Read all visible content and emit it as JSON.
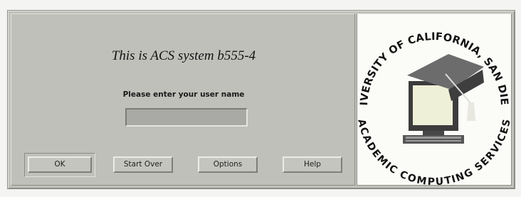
{
  "dialog": {
    "title": "This is ACS system b555-4",
    "prompt": "Please enter your user name",
    "username_value": ""
  },
  "buttons": {
    "ok": "OK",
    "start_over": "Start Over",
    "options": "Options",
    "help": "Help"
  },
  "logo": {
    "top_text": "UNIVERSITY OF CALIFORNIA, SAN DIEGO",
    "bottom_text": "ACADEMIC COMPUTING SERVICES",
    "icon": "computer-with-graduation-cap"
  },
  "colors": {
    "window_bg": "#c2c2bd",
    "field_bg": "#a9aaa5",
    "logo_bg": "#fbfbf8",
    "screen": "#eff0d8"
  }
}
